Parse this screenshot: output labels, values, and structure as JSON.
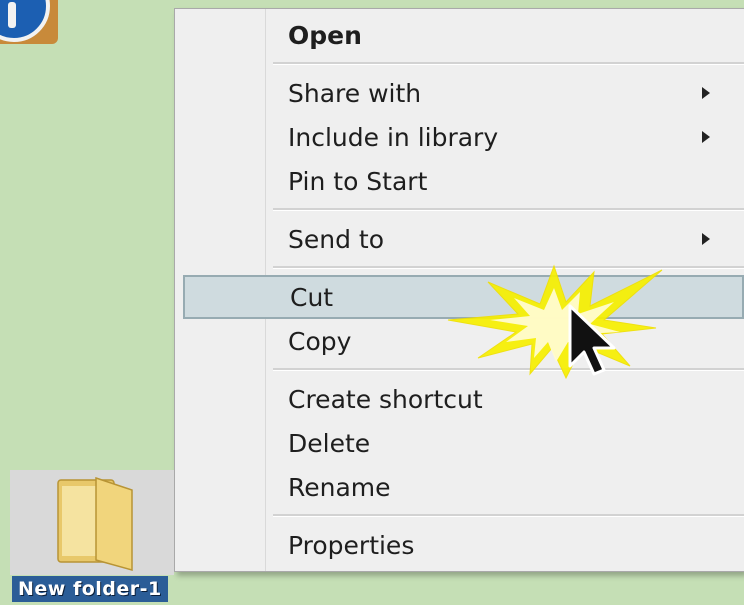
{
  "context_menu": {
    "items": [
      {
        "label": "Open",
        "bold": true
      },
      {
        "label": "Share with",
        "submenu": true
      },
      {
        "label": "Include in library",
        "submenu": true
      },
      {
        "label": "Pin to Start"
      },
      {
        "label": "Send to",
        "submenu": true
      },
      {
        "label": "Cut",
        "highlighted": true
      },
      {
        "label": "Copy"
      },
      {
        "label": "Create shortcut"
      },
      {
        "label": "Delete"
      },
      {
        "label": "Rename"
      },
      {
        "label": "Properties"
      }
    ]
  },
  "desktop": {
    "folder_label": "New folder-1"
  },
  "colors": {
    "desktop_background": "#c5dfb5",
    "menu_background": "#efefef",
    "highlight": "#cfdbdf",
    "starburst": "#f7f000"
  },
  "icons": {
    "top_left": "partial-app-icon",
    "folder": "folder-icon",
    "submenu": "chevron-right-icon",
    "pointer": "mouse-pointer-icon"
  }
}
